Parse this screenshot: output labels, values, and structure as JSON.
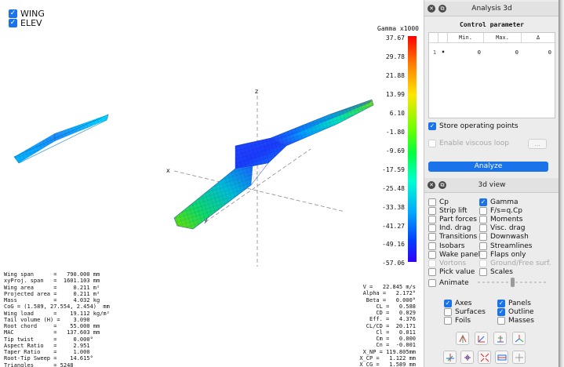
{
  "viewport": {
    "toggles": [
      {
        "label": "WING",
        "checked": true
      },
      {
        "label": "ELEV",
        "checked": true
      }
    ],
    "axes": {
      "x": "x",
      "y": "y",
      "z": "z"
    },
    "legend": {
      "title": "Gamma x1000",
      "ticks": [
        "37.67",
        "29.78",
        "21.88",
        "13.99",
        "6.10",
        "-1.80",
        "-9.69",
        "-17.59",
        "-25.48",
        "-33.38",
        "-41.27",
        "-49.16",
        "-57.06"
      ]
    },
    "wing_stats": [
      "Wing span      =   790.000 mm",
      "xyProj. span   =  1601.103 mm",
      "Wing area      =     0.211 m²",
      "Projected area =     0.211 m²",
      "Mass           =     4.032 kg",
      "CoG = (1.589, 27.554, 2.454)  mm",
      "Wing load      =    19.112 kg/m²",
      "Tail volume (H) =    3.090",
      "Root chord     =    55.000 mm",
      "MAC            =   137.603 mm",
      "Tip twist      =     0.000°",
      "Aspect Ratio   =     2.951",
      "Taper Ratio    =     1.000",
      "Root-Tip Sweep =    14.615°",
      "Triangles      = 5248"
    ],
    "flight_stats": [
      "V =   22.845 m/s",
      "Alpha =   2.172°",
      "Beta =   0.000°",
      "CL =   0.588",
      "CD =   0.029",
      "Eff. =   4.376",
      "CL/CD =  20.171",
      "Cl =   0.011",
      "Cm =   0.000",
      "Cn =  -0.001",
      "X_NP = 119.805mm",
      "X_CP =   1.122 mm",
      "X_CG =   1.589 mm"
    ]
  },
  "analysis_panel": {
    "title": "Analysis 3d",
    "close_glyph": "✕",
    "detach_glyph": "⧉",
    "control_label": "Control parameter",
    "table": {
      "headers": [
        "Min.",
        "Max.",
        "Δ"
      ],
      "row": {
        "index": "1",
        "marker": "✖",
        "min": "0",
        "max": "0",
        "delta": "0"
      }
    },
    "store_label": "Store operating points",
    "store_checked": true,
    "viscous_label": "Enable viscous loop",
    "dots_label": "...",
    "analyze_label": "Analyze"
  },
  "view_panel": {
    "title": "3d view",
    "left_col": [
      {
        "label": "Cp",
        "checked": false,
        "enabled": true
      },
      {
        "label": "Strip lift",
        "checked": false,
        "enabled": true
      },
      {
        "label": "Part forces",
        "checked": false,
        "enabled": true
      },
      {
        "label": "Ind. drag",
        "checked": false,
        "enabled": true
      },
      {
        "label": "Transitions",
        "checked": false,
        "enabled": true
      },
      {
        "label": "Isobars",
        "checked": false,
        "enabled": true
      },
      {
        "label": "Wake panels",
        "checked": false,
        "enabled": true
      },
      {
        "label": "Vortons",
        "checked": false,
        "enabled": false
      },
      {
        "label": "Pick value",
        "checked": false,
        "enabled": true
      }
    ],
    "right_col": [
      {
        "label": "Gamma",
        "checked": true,
        "enabled": true
      },
      {
        "label": "F/s=q.Cp",
        "checked": false,
        "enabled": true
      },
      {
        "label": "Moments",
        "checked": false,
        "enabled": true
      },
      {
        "label": "Visc. drag",
        "checked": false,
        "enabled": true
      },
      {
        "label": "Downwash",
        "checked": false,
        "enabled": true
      },
      {
        "label": "Streamlines",
        "checked": false,
        "enabled": true
      },
      {
        "label": "Flaps only",
        "checked": false,
        "enabled": true
      },
      {
        "label": "Ground/Free surf.",
        "checked": false,
        "enabled": false
      },
      {
        "label": "Scales",
        "checked": false,
        "enabled": true
      }
    ],
    "animate_label": "Animate",
    "animate_checked": false,
    "display_left": [
      {
        "label": "Axes",
        "checked": true
      },
      {
        "label": "Surfaces",
        "checked": false
      },
      {
        "label": "Foils",
        "checked": false
      }
    ],
    "display_right": [
      {
        "label": "Panels",
        "checked": true
      },
      {
        "label": "Outline",
        "checked": true
      },
      {
        "label": "Masses",
        "checked": false
      }
    ],
    "view_buttons_row1": [
      "view-x-icon",
      "view-y-icon",
      "view-z-icon",
      "view-iso-icon"
    ],
    "view_buttons_row2": [
      "flip-view-icon",
      "reset-view-icon",
      "fit-view-icon",
      "screenshot-icon",
      "clip-plane-icon"
    ]
  },
  "colors": {
    "accent": "#1a73e8",
    "panel_bg": "#ececec",
    "title_bg": "#e2e2e2"
  }
}
